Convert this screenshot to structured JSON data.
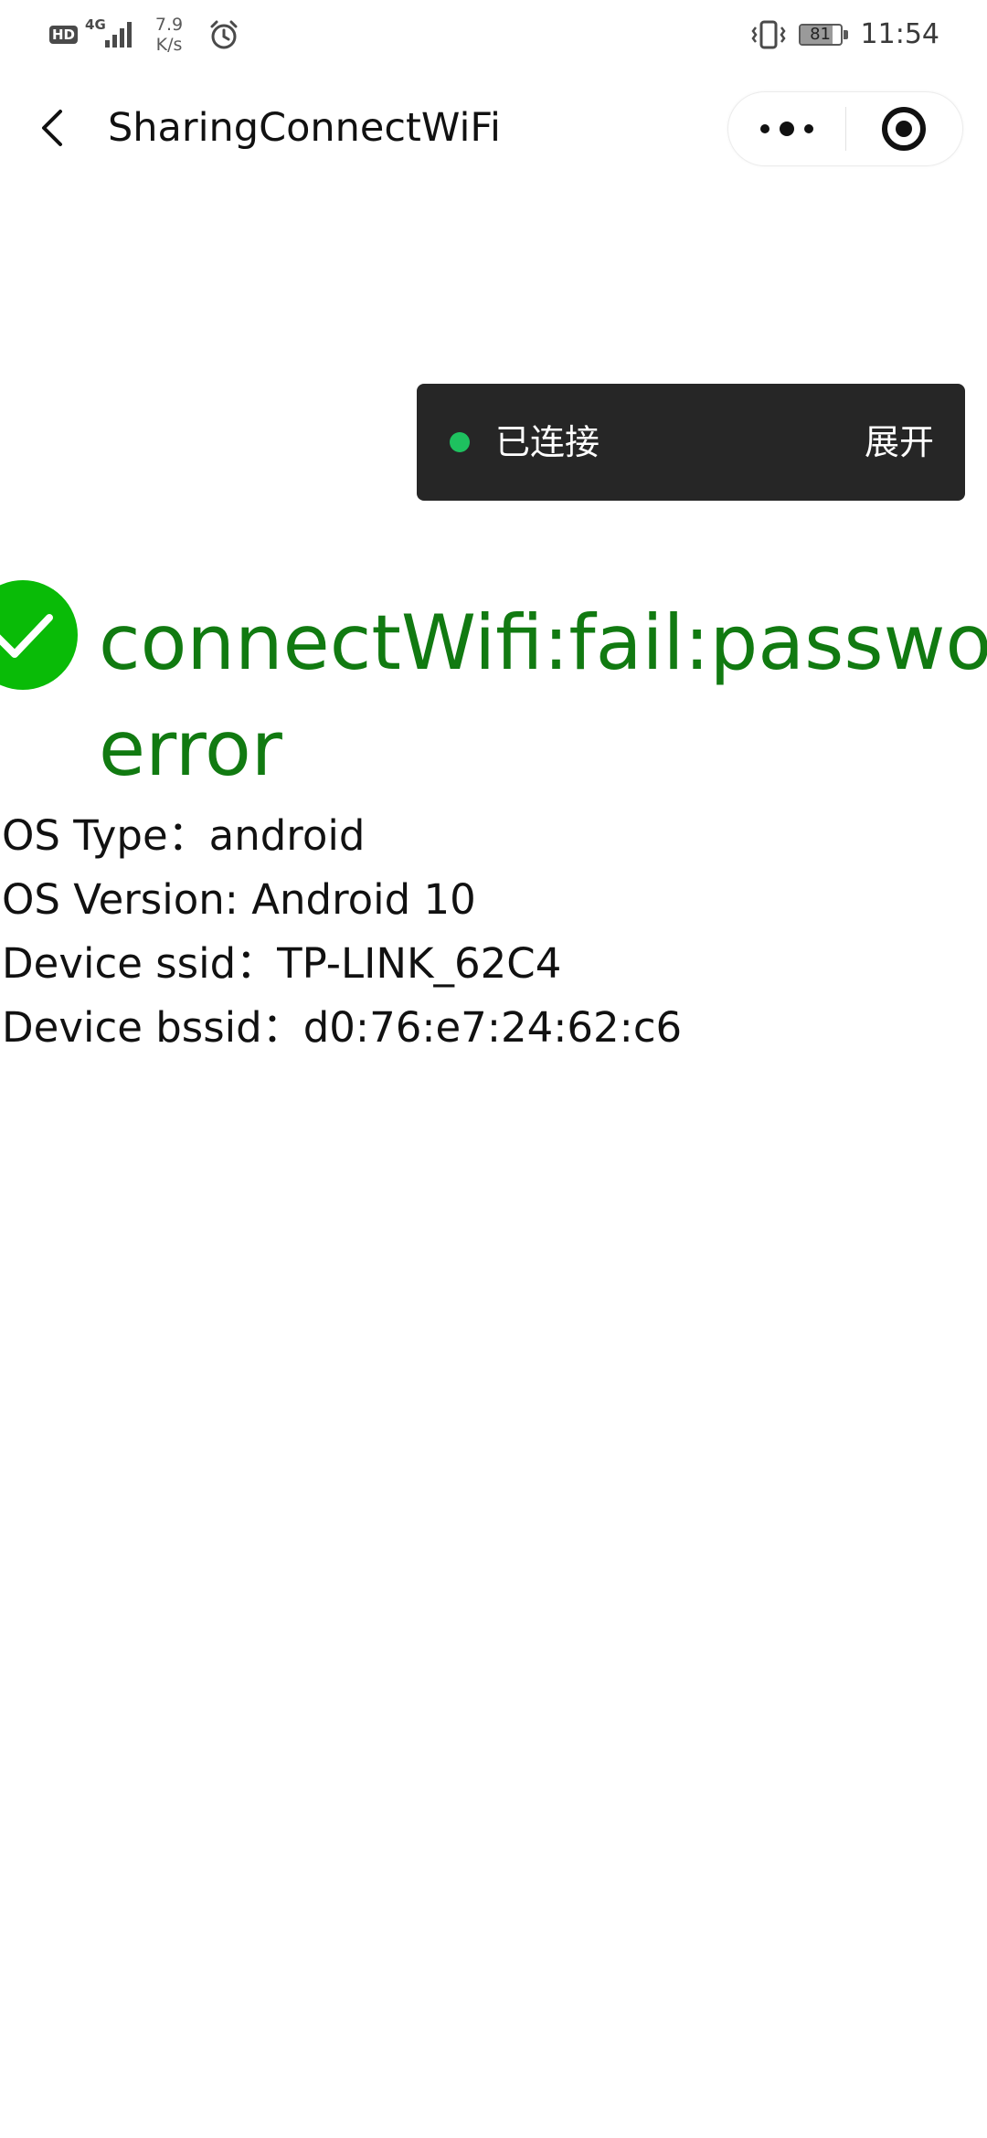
{
  "status_bar": {
    "hd_label": "HD",
    "network_generation": "4G",
    "speed_value": "7.9",
    "speed_unit": "K/s",
    "battery_level": "81",
    "time": "11:54",
    "icons": [
      "hd-icon",
      "signal-icon",
      "alarm-icon",
      "vibrate-icon",
      "battery-icon"
    ]
  },
  "nav": {
    "title": "SharingConnectWiFi",
    "icons": [
      "back-icon",
      "more-icon",
      "close-mini-program-icon"
    ]
  },
  "toast": {
    "status_text": "已连接",
    "expand_label": "展开",
    "dot_color": "#1ec15f"
  },
  "result": {
    "icon": "success-check-icon",
    "icon_color": "#09bb07",
    "text_color": "#117a11",
    "title_line1": "connectWifi:fail:password",
    "title_line2": "error"
  },
  "info": {
    "os_type": "OS Type：android",
    "os_version": "OS Version: Android 10",
    "device_ssid": "Device ssid：TP-LINK_62C4",
    "device_bssid": "Device bssid：d0:76:e7:24:62:c6"
  }
}
